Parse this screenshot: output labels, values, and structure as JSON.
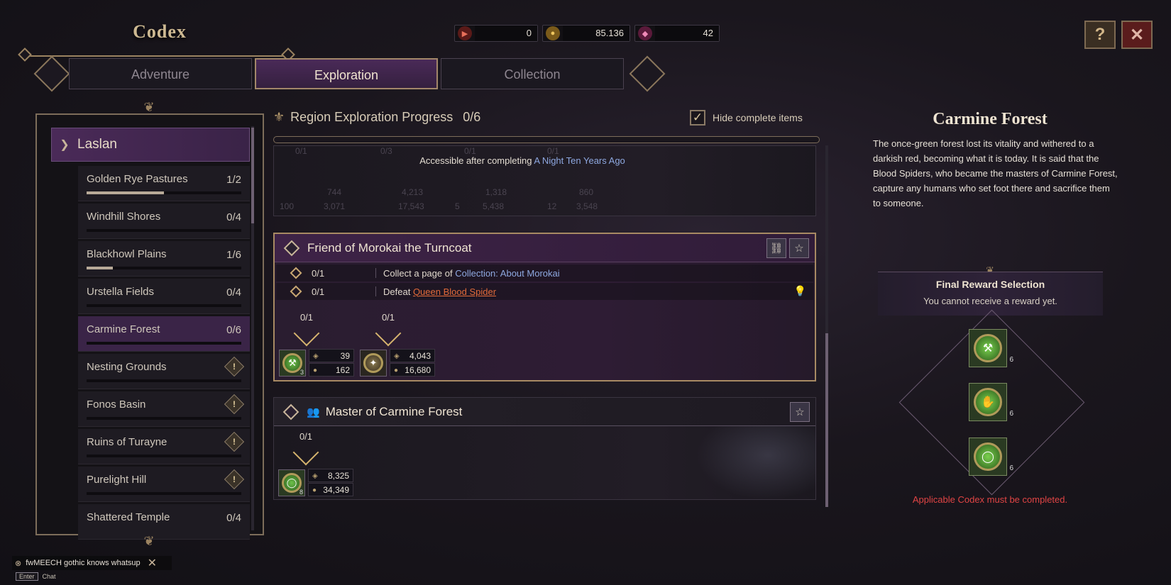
{
  "header": {
    "title": "Codex",
    "currencies": [
      {
        "icon": "red-ticket-icon",
        "value": "0",
        "color": "#c8423a"
      },
      {
        "icon": "gold-coin-icon",
        "value": "85.136",
        "color": "#c8a24a"
      },
      {
        "icon": "pink-crystal-icon",
        "value": "42",
        "color": "#c85a8a"
      }
    ],
    "help_icon": "help-book-icon",
    "close_icon": "close-icon"
  },
  "tabs": [
    {
      "label": "Adventure",
      "active": false
    },
    {
      "label": "Exploration",
      "active": true
    },
    {
      "label": "Collection",
      "active": false
    }
  ],
  "regions": {
    "group": "Laslan",
    "items": [
      {
        "name": "Golden Rye Pastures",
        "progress": "1/2",
        "fill": 0.5,
        "locked": false,
        "active": false
      },
      {
        "name": "Windhill Shores",
        "progress": "0/4",
        "fill": 0,
        "locked": false,
        "active": false
      },
      {
        "name": "Blackhowl Plains",
        "progress": "1/6",
        "fill": 0.17,
        "locked": false,
        "active": false
      },
      {
        "name": "Urstella Fields",
        "progress": "0/4",
        "fill": 0,
        "locked": false,
        "active": false
      },
      {
        "name": "Carmine Forest",
        "progress": "0/6",
        "fill": 0,
        "locked": false,
        "active": true
      },
      {
        "name": "Nesting Grounds",
        "progress": "",
        "fill": 0,
        "locked": true,
        "active": false
      },
      {
        "name": "Fonos Basin",
        "progress": "",
        "fill": 0,
        "locked": true,
        "active": false
      },
      {
        "name": "Ruins of Turayne",
        "progress": "",
        "fill": 0,
        "locked": true,
        "active": false
      },
      {
        "name": "Purelight Hill",
        "progress": "",
        "fill": 0,
        "locked": true,
        "active": false
      },
      {
        "name": "Shattered Temple",
        "progress": "0/4",
        "fill": 0,
        "locked": false,
        "active": false
      }
    ]
  },
  "middle": {
    "progress_label": "Region Exploration Progress",
    "progress_value": "0/6",
    "hide_complete_label": "Hide complete items",
    "hide_complete_checked": true,
    "top_card": {
      "accessible_text": "Accessible after completing",
      "accessible_link": "A Night Ten Years Ago",
      "ghost_counts": [
        "0/1",
        "0/3",
        "0/1",
        "0/1"
      ],
      "ghost_values": [
        {
          "qty": "100",
          "a": "744",
          "b": "3,071"
        },
        {
          "qty": "",
          "a": "4,213",
          "b": "17,543"
        },
        {
          "qty": "5",
          "a": "1,318",
          "b": "5,438"
        },
        {
          "qty": "12",
          "a": "860",
          "b": "3,548"
        }
      ]
    },
    "friend_card": {
      "title": "Friend of Morokai the Turncoat",
      "tasks": [
        {
          "count": "0/1",
          "text": "Collect a page of",
          "link": "Collection: About Morokai",
          "link_style": "blue"
        },
        {
          "count": "0/1",
          "text": "Defeat",
          "link": "Queen Blood Spider",
          "link_style": "orange"
        }
      ],
      "milestones": [
        "0/1",
        "0/1"
      ],
      "rewards": [
        {
          "icon": "green-emblem-icon",
          "qty": "3",
          "a": "39",
          "b": "162"
        },
        {
          "icon": "beast-emblem-icon",
          "qty": "",
          "a": "4,043",
          "b": "16,680"
        }
      ]
    },
    "master_card": {
      "title": "Master of Carmine Forest",
      "milestone": "0/1",
      "reward": {
        "icon": "green-ring-icon",
        "qty": "8",
        "a": "8,325",
        "b": "34,349"
      }
    }
  },
  "right": {
    "title": "Carmine Forest",
    "description": "The once-green forest lost its vitality and withered to a darkish red, becoming what it is today. It is said that the Blood Spiders, who became the masters of Carmine Forest, capture any humans who set foot there and sacrifice them to someone.",
    "reward_title": "Final Reward Selection",
    "reward_subtitle": "You cannot receive a reward yet.",
    "final_rewards": [
      {
        "icon": "green-hammer-emblem-icon",
        "qty": "6"
      },
      {
        "icon": "green-glove-emblem-icon",
        "qty": "6"
      },
      {
        "icon": "green-ring-emblem-icon",
        "qty": "6"
      }
    ],
    "warning": "Applicable Codex must be completed."
  },
  "chat": {
    "message": "fwMEECH gothic knows whatsup",
    "enter_key": "Enter",
    "chat_label": "Chat"
  },
  "colors": {
    "accent_purple": "#3a2447",
    "gold": "#c8a772",
    "warning_red": "#e04444",
    "link_blue": "#8ea8e0",
    "link_orange": "#e06a3a"
  }
}
